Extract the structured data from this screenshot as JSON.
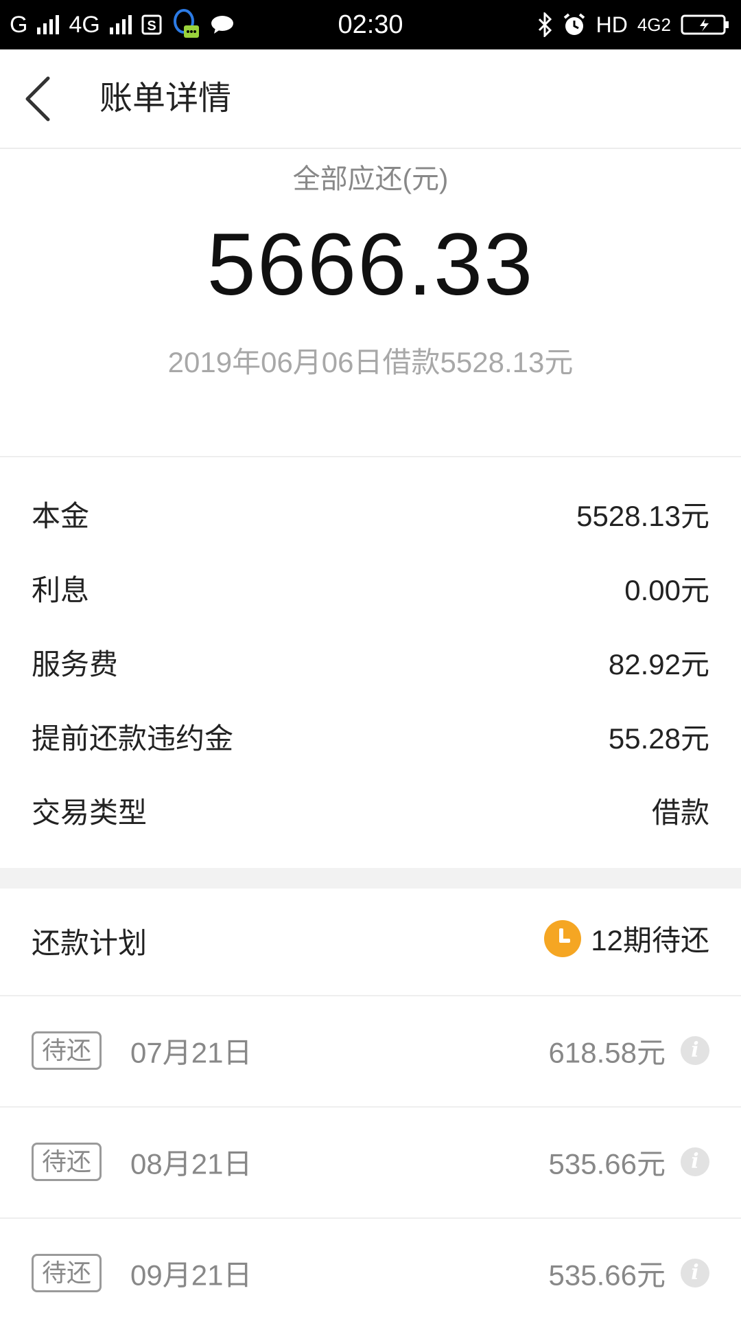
{
  "status_bar": {
    "carrier1": "G",
    "network": "4G",
    "time": "02:30",
    "hd": "HD",
    "lte": "4G2"
  },
  "header": {
    "title": "账单详情"
  },
  "summary": {
    "label": "全部应还(元)",
    "amount": "5666.33",
    "subtitle": "2019年06月06日借款5528.13元"
  },
  "details": [
    {
      "label": "本金",
      "value": "5528.13元"
    },
    {
      "label": "利息",
      "value": "0.00元"
    },
    {
      "label": "服务费",
      "value": "82.92元"
    },
    {
      "label": "提前还款违约金",
      "value": "55.28元"
    },
    {
      "label": "交易类型",
      "value": "借款"
    }
  ],
  "plan": {
    "title": "还款计划",
    "status": "12期待还",
    "status_color": "#f5a623",
    "items": [
      {
        "badge": "待还",
        "date": "07月21日",
        "amount": "618.58元"
      },
      {
        "badge": "待还",
        "date": "08月21日",
        "amount": "535.66元"
      },
      {
        "badge": "待还",
        "date": "09月21日",
        "amount": "535.66元"
      }
    ]
  }
}
